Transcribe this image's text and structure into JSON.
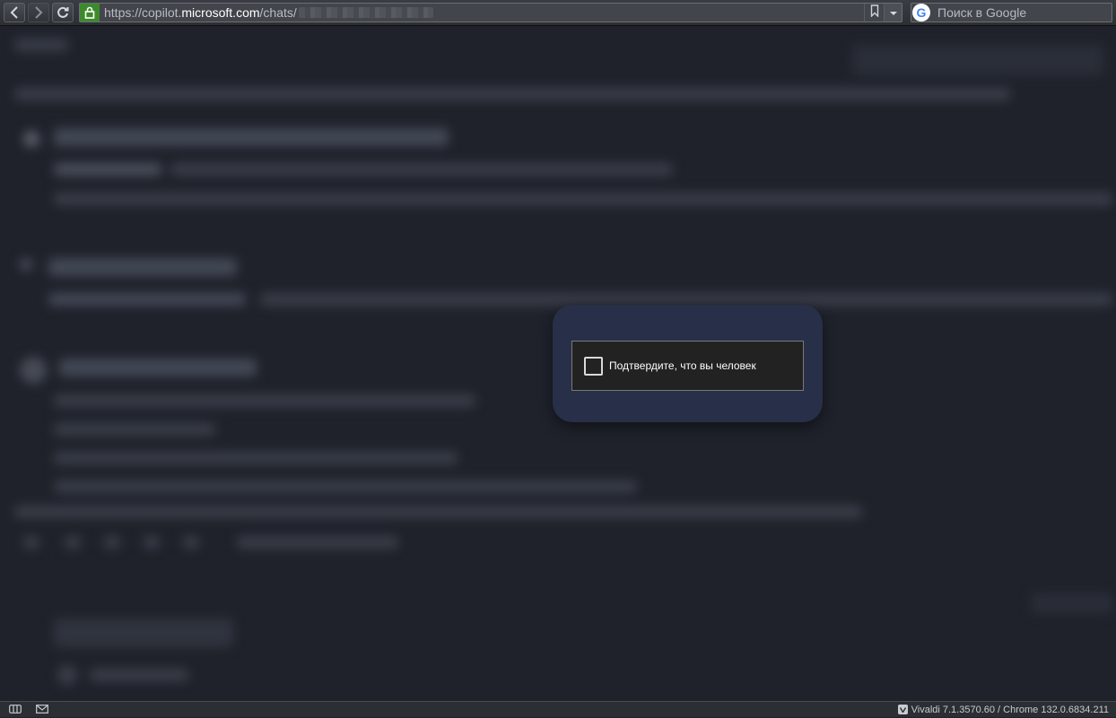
{
  "browser": {
    "url_scheme_host_prefix": "https://copilot.",
    "url_domain": "microsoft.com",
    "url_path": "/chats/",
    "search_placeholder": "Поиск в Google",
    "search_engine_letter": "G"
  },
  "captcha": {
    "label": "Подтвердите, что вы человек"
  },
  "statusbar": {
    "version": "Vivaldi 7.1.3570.60 / Chrome 132.0.6834.211"
  },
  "colors": {
    "page_bg": "#1f222b",
    "modal_bg": "#282f48",
    "captcha_bg": "#222222",
    "lock_green": "#3d8a2c"
  },
  "icons": {
    "back": "chevron-left-icon",
    "forward": "chevron-right-icon",
    "reload": "reload-icon",
    "lock": "lock-icon",
    "bookmark": "bookmark-icon",
    "dropdown": "chevron-down-icon",
    "panel": "panel-toggle-icon",
    "mail": "mail-icon",
    "vivaldi": "vivaldi-icon"
  }
}
